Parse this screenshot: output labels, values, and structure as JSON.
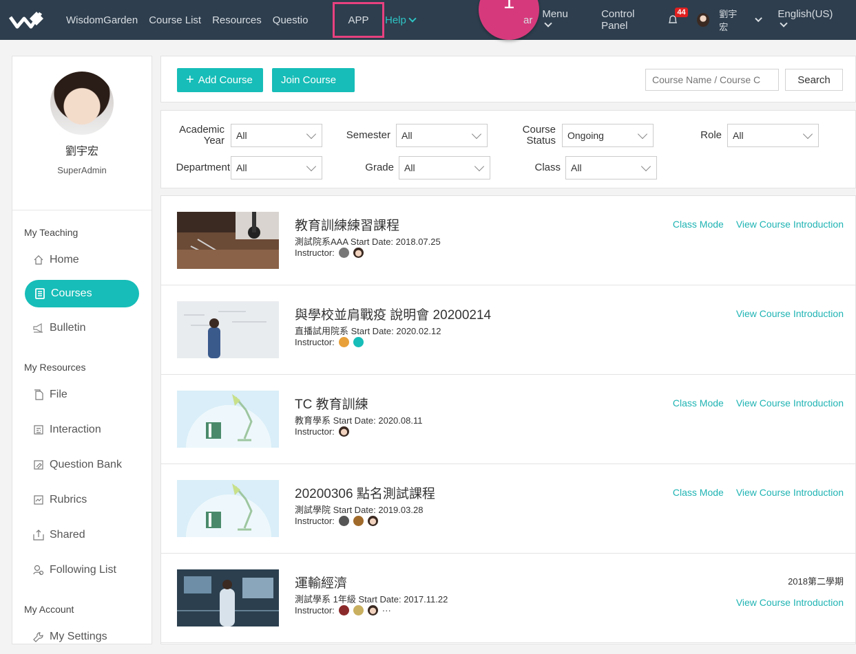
{
  "topnav": {
    "items": [
      "WisdomGarden",
      "Course List",
      "Resources",
      "Questio"
    ],
    "app": "APP",
    "help": "Help",
    "callout": "1",
    "calendar": "ar",
    "menu": "Menu",
    "control_panel": "Control Panel",
    "notifications": "44",
    "user": "劉宇宏",
    "language": "English(US)"
  },
  "sidebar": {
    "name": "劉宇宏",
    "role": "SuperAdmin",
    "sections": {
      "teaching": "My Teaching",
      "resources": "My Resources",
      "account": "My Account"
    },
    "items": {
      "home": "Home",
      "courses": "Courses",
      "bulletin": "Bulletin",
      "file": "File",
      "interaction": "Interaction",
      "question_bank": "Question Bank",
      "rubrics": "Rubrics",
      "shared": "Shared",
      "following": "Following List",
      "settings": "My Settings"
    }
  },
  "toolbar": {
    "add_course": "Add Course",
    "join_course": "Join Course",
    "search_placeholder": "Course Name / Course C",
    "search_button": "Search"
  },
  "filters": {
    "academic_year": {
      "label1": "Academic",
      "label2": "Year",
      "value": "All"
    },
    "semester": {
      "label": "Semester",
      "value": "All"
    },
    "course_status": {
      "label1": "Course",
      "label2": "Status",
      "value": "Ongoing"
    },
    "role": {
      "label": "Role",
      "value": "All"
    },
    "department": {
      "label": "Department",
      "value": "All"
    },
    "grade": {
      "label": "Grade",
      "value": "All"
    },
    "class": {
      "label": "Class",
      "value": "All"
    }
  },
  "courses": [
    {
      "title": "教育訓練練習課程",
      "meta": "測試院系AAA   Start Date: 2018.07.25",
      "instructor": "Instructor:",
      "class_mode": "Class Mode",
      "intro": "View Course Introduction"
    },
    {
      "title": "與學校並肩戰疫 說明會 20200214",
      "meta": "直播試用院系   Start Date: 2020.02.12",
      "instructor": "Instructor:",
      "intro": "View Course Introduction"
    },
    {
      "title": "TC 教育訓練",
      "meta": "教育學系   Start Date: 2020.08.11",
      "instructor": "Instructor:",
      "class_mode": "Class Mode",
      "intro": "View Course Introduction"
    },
    {
      "title": "20200306 點名測試課程",
      "meta": "測試學院   Start Date: 2019.03.28",
      "instructor": "Instructor:",
      "class_mode": "Class Mode",
      "intro": "View Course Introduction"
    },
    {
      "title": "運輸經濟",
      "meta": "測試學系   1年級   Start Date: 2017.11.22",
      "instructor": "Instructor:",
      "more": "···",
      "semester": "2018第二學期",
      "intro": "View Course Introduction"
    }
  ]
}
